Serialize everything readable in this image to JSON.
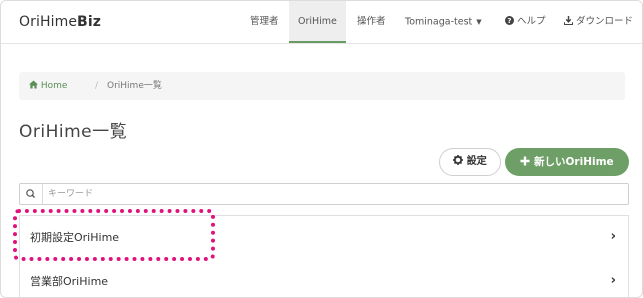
{
  "brand": {
    "prefix": "OriHime",
    "suffix": "Biz"
  },
  "nav": {
    "items": [
      {
        "label": "管理者"
      },
      {
        "label": "OriHime"
      },
      {
        "label": "操作者"
      },
      {
        "label": "Tominaga-test"
      },
      {
        "label": "ヘルプ"
      },
      {
        "label": "ダウンロード"
      }
    ],
    "active": "OriHime"
  },
  "breadcrumb": {
    "home": "Home",
    "separator": "/",
    "current": "OriHime一覧"
  },
  "page": {
    "title": "OriHime一覧"
  },
  "buttons": {
    "settings": "設定",
    "new": "新しいOriHime"
  },
  "search": {
    "placeholder": "キーワード",
    "value": ""
  },
  "list": {
    "items": [
      {
        "label": "初期設定OriHime"
      },
      {
        "label": "営業部OriHime"
      }
    ]
  },
  "colors": {
    "accent": "#6e9f66",
    "highlight": "#e0127f",
    "link": "#5b8f55"
  },
  "icons": [
    "home-icon",
    "gear-icon",
    "plus-icon",
    "search-icon",
    "help-icon",
    "download-icon",
    "chevron-right-icon",
    "caret-down-icon"
  ]
}
